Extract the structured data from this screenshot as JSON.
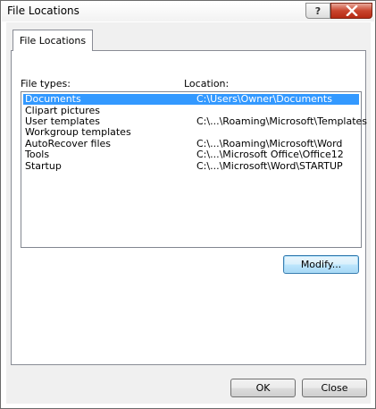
{
  "window": {
    "title": "File Locations",
    "help_label": "?"
  },
  "tab": {
    "label": "File Locations"
  },
  "columns": {
    "file_types": "File types:",
    "location": "Location:"
  },
  "file_types": [
    {
      "type": "Documents",
      "path": "C:\\Users\\Owner\\Documents",
      "selected": true
    },
    {
      "type": "Clipart pictures",
      "path": ""
    },
    {
      "type": "User templates",
      "path": "C:\\...\\Roaming\\Microsoft\\Templates"
    },
    {
      "type": "Workgroup templates",
      "path": ""
    },
    {
      "type": "AutoRecover files",
      "path": "C:\\...\\Roaming\\Microsoft\\Word"
    },
    {
      "type": "Tools",
      "path": "C:\\...\\Microsoft Office\\Office12"
    },
    {
      "type": "Startup",
      "path": "C:\\...\\Microsoft\\Word\\STARTUP"
    }
  ],
  "buttons": {
    "modify": "Modify...",
    "ok": "OK",
    "close": "Close"
  },
  "colors": {
    "selection": "#3399ff",
    "close_button": "#c9452e"
  }
}
